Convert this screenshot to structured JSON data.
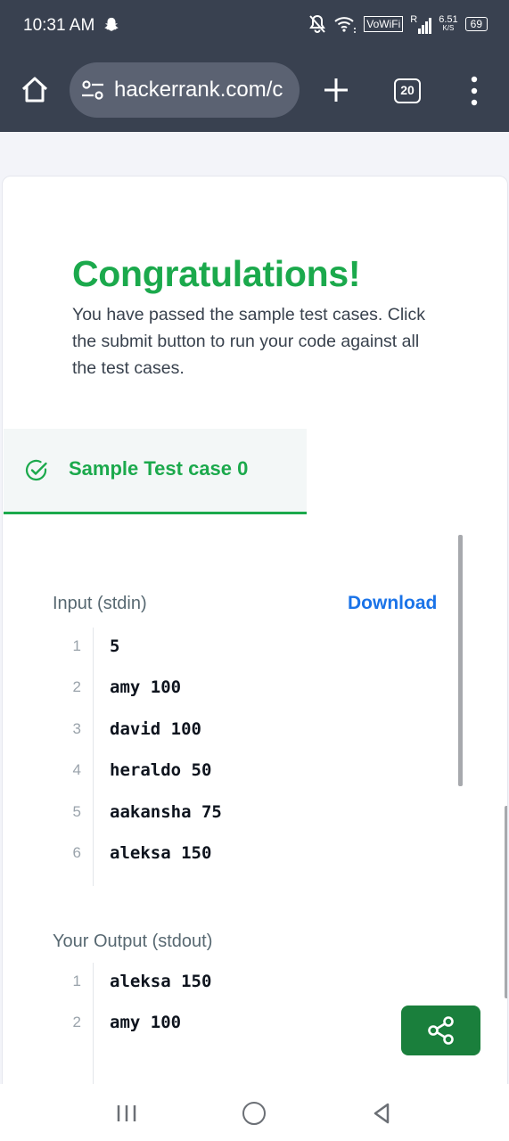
{
  "status_bar": {
    "time": "10:31 AM",
    "vowifi": "VoWiFi",
    "signal_label": "R",
    "speed_value": "6.51",
    "speed_unit": "K/S",
    "battery": "69",
    "icons": [
      "snapchat-icon",
      "mute-icon",
      "wifi-icon",
      "signal-icon",
      "battery-icon"
    ]
  },
  "browser": {
    "url": "hackerrank.com/c",
    "tab_count": "20",
    "icons": [
      "home-icon",
      "tune-icon",
      "plus-icon",
      "tabs-icon",
      "menu-icon"
    ]
  },
  "result": {
    "title": "Congratulations!",
    "message": "You have passed the sample test cases. Click the submit button to run your code against all the test cases."
  },
  "tab": {
    "label": "Sample Test case 0",
    "icon": "check-circle-icon"
  },
  "input": {
    "label": "Input (stdin)",
    "download_label": "Download",
    "lines": [
      {
        "n": "1",
        "text": "5"
      },
      {
        "n": "2",
        "text": "amy 100"
      },
      {
        "n": "3",
        "text": "david 100"
      },
      {
        "n": "4",
        "text": "heraldo 50"
      },
      {
        "n": "5",
        "text": "aakansha 75"
      },
      {
        "n": "6",
        "text": "aleksa 150"
      }
    ]
  },
  "output": {
    "label": "Your Output (stdout)",
    "lines": [
      {
        "n": "1",
        "text": "aleksa 150"
      },
      {
        "n": "2",
        "text": "amy 100"
      }
    ]
  },
  "share": {
    "icon": "share-icon"
  },
  "nav": {
    "icons": [
      "recent-apps-icon",
      "home-circle-icon",
      "back-icon"
    ]
  },
  "colors": {
    "accent_green": "#1ba94c",
    "link_blue": "#1a73e8",
    "browser_bar": "#394150"
  }
}
